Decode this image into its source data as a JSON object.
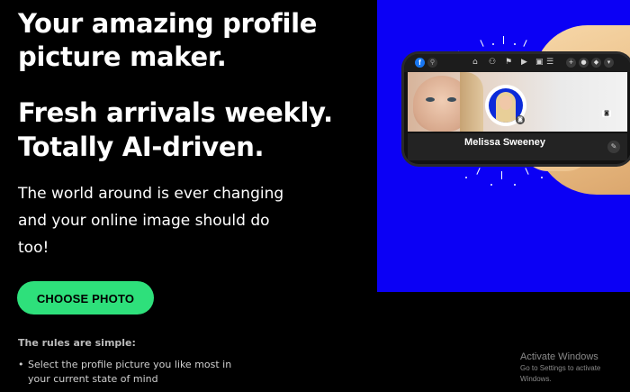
{
  "hero": {
    "title": "Your amazing profile picture maker.",
    "subtitle": "Fresh arrivals weekly. Totally AI-driven.",
    "description": "The world around is ever changing and your online image should do too!",
    "cta_label": "CHOOSE PHOTO"
  },
  "rules": {
    "title": "The rules are simple:",
    "items": [
      "Select the profile picture you like most in your current state of mind"
    ]
  },
  "promo": {
    "background_color": "#0b00f5",
    "profile_name": "Melissa Sweeney",
    "fb_glyph": "f"
  },
  "watermark": {
    "title": "Activate Windows",
    "subtitle": "Go to Settings to activate Windows."
  },
  "colors": {
    "accent": "#2ee07b",
    "background": "#000000"
  }
}
